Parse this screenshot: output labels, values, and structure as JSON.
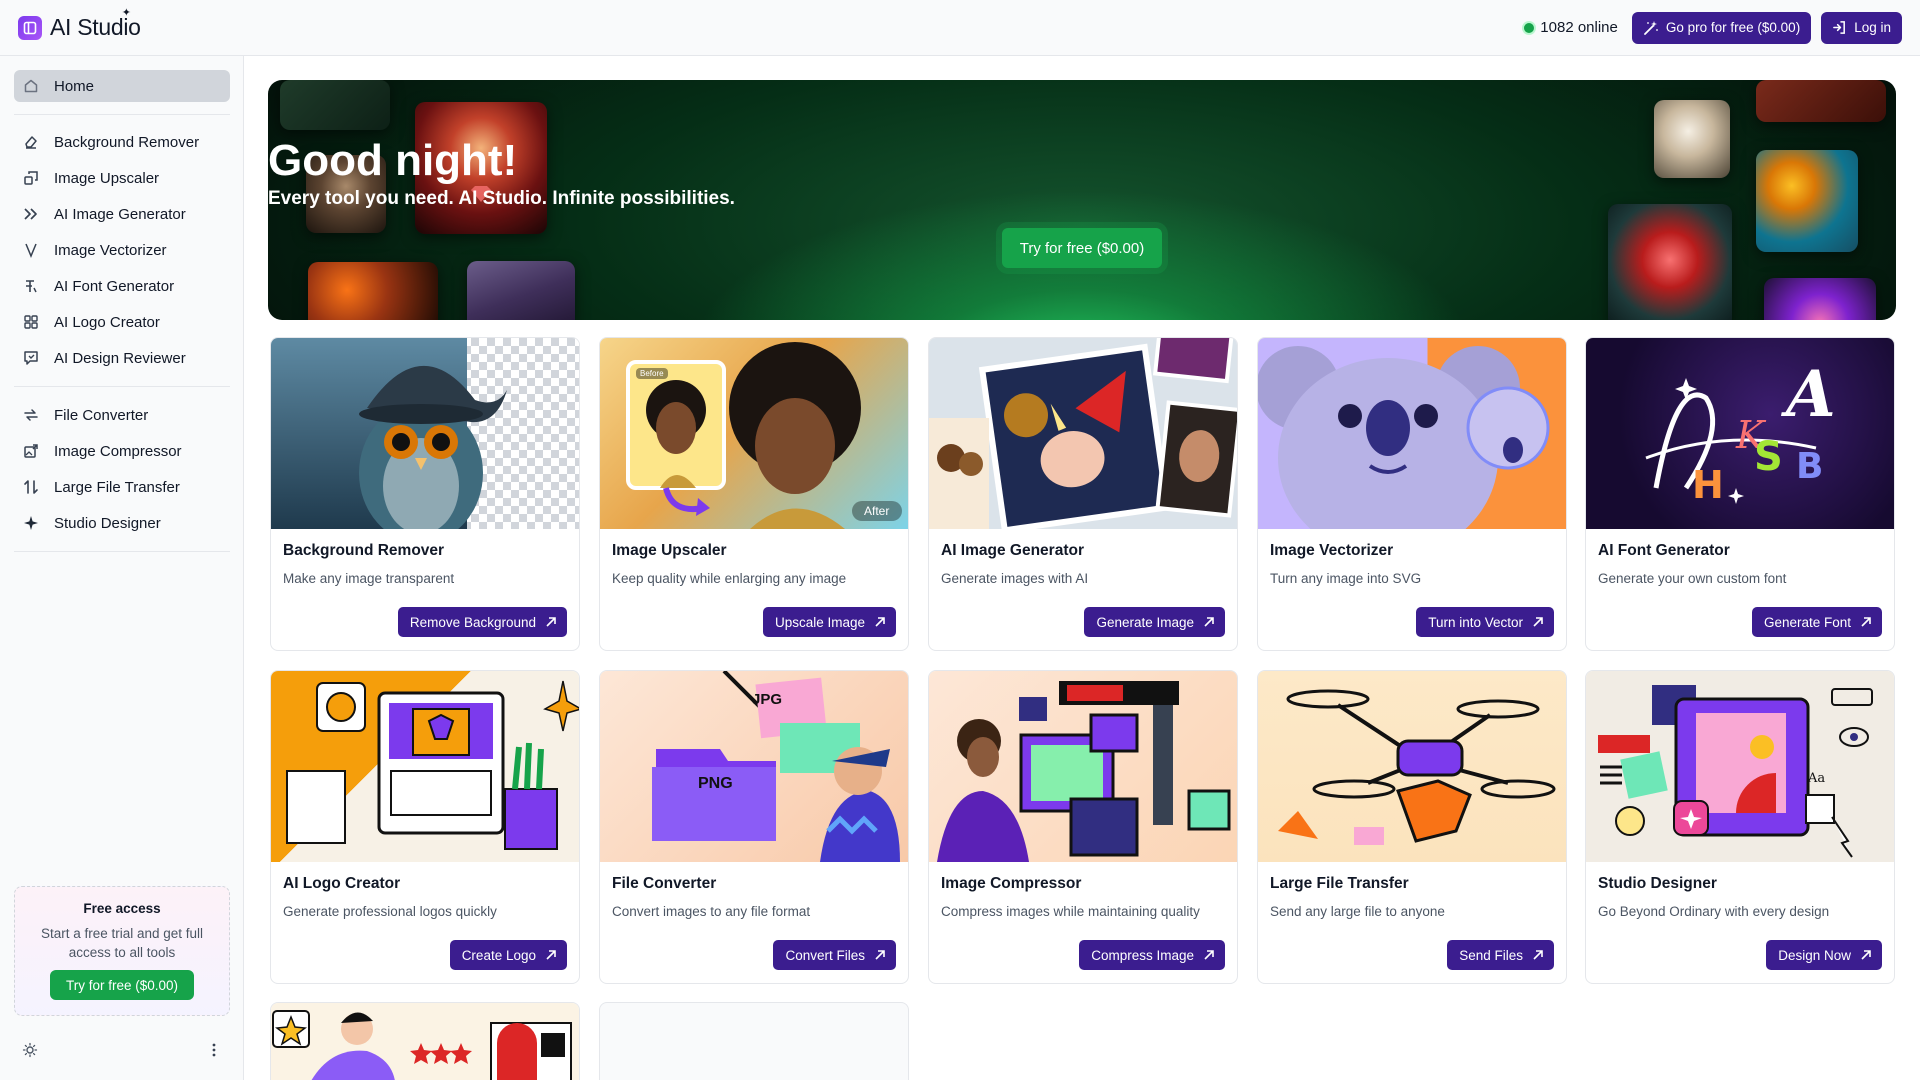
{
  "header": {
    "app_name": "AI Studio",
    "online_count": "1082 online",
    "go_pro_label": "Go pro for free ($0.00)",
    "login_label": "Log in"
  },
  "sidebar": {
    "items": [
      {
        "label": "Home",
        "icon": "home-icon",
        "active": true
      },
      {
        "label": "Background Remover",
        "icon": "eraser-icon"
      },
      {
        "label": "Image Upscaler",
        "icon": "upscale-icon"
      },
      {
        "label": "AI Image Generator",
        "icon": "double-chevron-icon"
      },
      {
        "label": "Image Vectorizer",
        "icon": "vector-icon"
      },
      {
        "label": "AI Font Generator",
        "icon": "font-icon"
      },
      {
        "label": "AI Logo Creator",
        "icon": "logo-grid-icon"
      },
      {
        "label": "AI Design Reviewer",
        "icon": "review-icon"
      },
      {
        "label": "File Converter",
        "icon": "convert-icon"
      },
      {
        "label": "Image Compressor",
        "icon": "compress-icon"
      },
      {
        "label": "Large File Transfer",
        "icon": "transfer-icon"
      },
      {
        "label": "Studio Designer",
        "icon": "sparkle-icon"
      }
    ],
    "free_access": {
      "title": "Free access",
      "text": "Start a free trial and get full access to all tools",
      "button": "Try for free ($0.00)"
    }
  },
  "hero": {
    "title": "Good night!",
    "subtitle": "Every tool you need. AI Studio. Infinite possibilities.",
    "button": "Try for free ($0.00)"
  },
  "tools": [
    {
      "title": "Background Remover",
      "desc": "Make any image transparent",
      "button": "Remove Background"
    },
    {
      "title": "Image Upscaler",
      "desc": "Keep quality while enlarging any image",
      "button": "Upscale Image",
      "before_label": "Before",
      "after_label": "After"
    },
    {
      "title": "AI Image Generator",
      "desc": "Generate images with AI",
      "button": "Generate Image"
    },
    {
      "title": "Image Vectorizer",
      "desc": "Turn any image into SVG",
      "button": "Turn into Vector"
    },
    {
      "title": "AI Font Generator",
      "desc": "Generate your own custom font",
      "button": "Generate Font"
    },
    {
      "title": "AI Logo Creator",
      "desc": "Generate professional logos quickly",
      "button": "Create Logo"
    },
    {
      "title": "File Converter",
      "desc": "Convert images to any file format",
      "button": "Convert Files",
      "tag_jpg": "JPG",
      "tag_png": "PNG"
    },
    {
      "title": "Image Compressor",
      "desc": "Compress images while maintaining quality",
      "button": "Compress Image"
    },
    {
      "title": "Large File Transfer",
      "desc": "Send any large file to anyone",
      "button": "Send Files"
    },
    {
      "title": "Studio Designer",
      "desc": "Go Beyond Ordinary with every design",
      "button": "Design Now",
      "aa_label": "Aa"
    }
  ],
  "colors": {
    "accent_purple": "#3b1d8f",
    "cta_green": "#16a34a",
    "hero_dark": "#052e16"
  }
}
